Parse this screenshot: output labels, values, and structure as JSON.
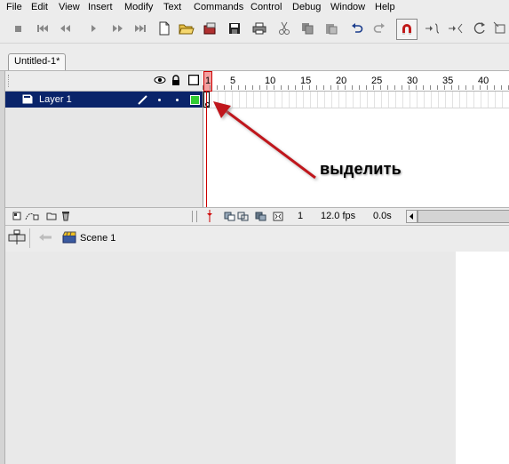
{
  "menu": [
    "File",
    "Edit",
    "View",
    "Insert",
    "Modify",
    "Text",
    "Commands",
    "Control",
    "Debug",
    "Window",
    "Help"
  ],
  "toolbar_icons": [
    "stop-icon",
    "rewind-start-icon",
    "step-back-icon",
    "play-icon",
    "step-forward-icon",
    "forward-end-icon",
    "new-document-icon",
    "open-folder-icon",
    "open-library-icon",
    "save-icon",
    "print-icon",
    "cut-icon",
    "copy-icon",
    "paste-icon",
    "undo-icon",
    "redo-icon",
    "snap-magnet-icon",
    "smooth-icon",
    "straighten-icon",
    "rotate-icon"
  ],
  "document_tab": {
    "label": "Untitled-1*"
  },
  "timeline": {
    "ruler": [
      "1",
      "5",
      "10",
      "15",
      "20",
      "25",
      "30",
      "35",
      "40"
    ],
    "layer_name": "Layer 1",
    "current_frame": "1",
    "frame_rate": "12.0 fps",
    "elapsed_time": "0.0s"
  },
  "editbar": {
    "scene_label": "Scene 1"
  },
  "annotation": {
    "text": "выделить"
  },
  "colors": {
    "selection": "#0a246a",
    "playhead": "#cc0000",
    "arrow": "#c0141a",
    "outline_color": "#33cc33"
  }
}
